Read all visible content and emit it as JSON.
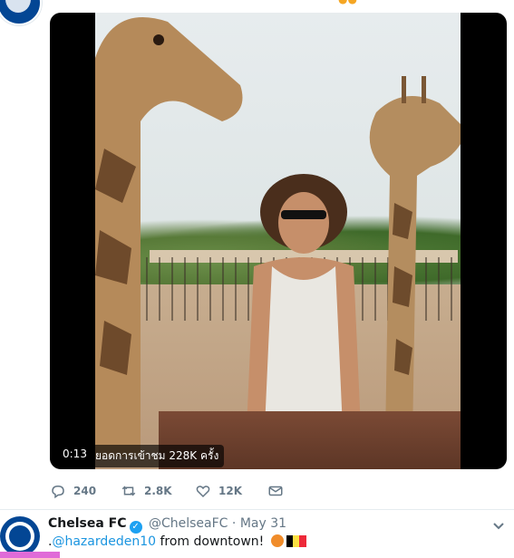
{
  "top_tweet": {
    "media": {
      "time": "0:13",
      "views": "ยอดการเข้าชม 228K ครั้ง"
    },
    "actions": {
      "reply_count": "240",
      "retweet_count": "2.8K",
      "like_count": "12K"
    }
  },
  "next_tweet": {
    "name": "Chelsea FC",
    "handle": "@ChelseaFC",
    "separator": "·",
    "date": "May 31",
    "text": {
      "prefix": ".",
      "mention": "@hazardeden10",
      "body": " from downtown! "
    },
    "emoji": [
      "basketball-emoji",
      "belgium-flag-emoji"
    ]
  },
  "colors": {
    "accent": "#1da1f2",
    "link": "#1b95e0",
    "muted": "#657786",
    "brand": "#034694"
  }
}
